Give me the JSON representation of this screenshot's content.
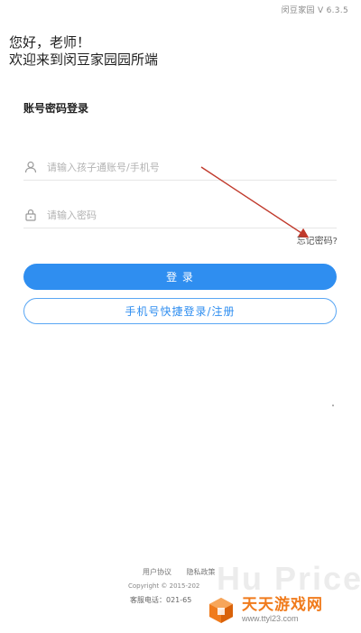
{
  "header": {
    "version": "闵豆家园 V 6.3.5"
  },
  "greeting": {
    "line1": "您好，老师！",
    "line2": "欢迎来到闵豆家园园所端"
  },
  "login": {
    "section_title": "账号密码登录",
    "username_placeholder": "请输入孩子通账号/手机号",
    "password_placeholder": "请输入密码",
    "forgot_label": "忘记密码?",
    "login_button": "登 录",
    "quick_login_button": "手机号快捷登录/注册"
  },
  "footer": {
    "user_agreement": "用户协议",
    "privacy_policy": "隐私政策",
    "copyright": "Copyright © 2015-202",
    "phone": "客服电话：021-65"
  },
  "watermark": {
    "bg_text": "Hu Price",
    "site_name": "天天游戏网",
    "site_url": "www.ttyl23.com"
  },
  "colors": {
    "primary": "#2f8ef0",
    "annotation_arrow": "#c0392b",
    "watermark_orange": "#f07b1c"
  },
  "icons": {
    "username": "user-icon",
    "password": "lock-icon",
    "watermark_logo": "cube-logo-icon"
  }
}
